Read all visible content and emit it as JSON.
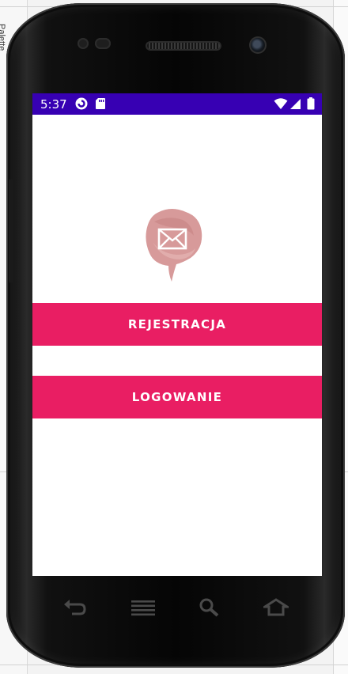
{
  "ide": {
    "side_panel_label": "Palette"
  },
  "status_bar": {
    "time": "5:37",
    "icons": [
      "data-saver-icon",
      "sd-card-icon",
      "wifi-icon",
      "signal-icon",
      "battery-icon"
    ],
    "color": "#3700b3"
  },
  "app": {
    "logo_icon": "envelope-icon",
    "buttons": {
      "register_label": "REJESTRACJA",
      "login_label": "LOGOWANIE"
    },
    "accent_color": "#e91e63"
  },
  "nav_bar": {
    "icons": [
      "back-icon",
      "menu-icon",
      "search-icon",
      "home-icon"
    ]
  }
}
